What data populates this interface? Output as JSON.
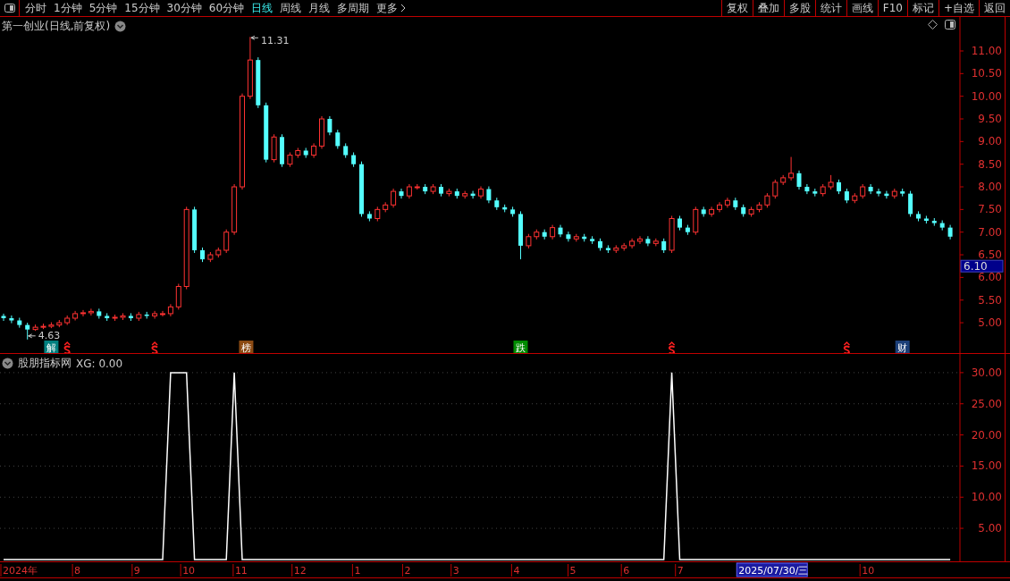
{
  "toolbar": {
    "tabs": [
      {
        "label": "分时",
        "selected": false
      },
      {
        "label": "1分钟",
        "selected": false
      },
      {
        "label": "5分钟",
        "selected": false
      },
      {
        "label": "15分钟",
        "selected": false
      },
      {
        "label": "30分钟",
        "selected": false
      },
      {
        "label": "60分钟",
        "selected": false
      },
      {
        "label": "日线",
        "selected": true
      },
      {
        "label": "周线",
        "selected": false
      },
      {
        "label": "月线",
        "selected": false
      },
      {
        "label": "多周期",
        "selected": false
      },
      {
        "label": "更多",
        "selected": false
      }
    ],
    "buttons": [
      "复权",
      "叠加",
      "多股",
      "统计",
      "画线",
      "F10",
      "标记",
      "+自选",
      "返回"
    ]
  },
  "price_chart": {
    "title": "第一创业(日线,前复权)",
    "last_price": "6.10",
    "chart_data": {
      "type": "candlestick",
      "ylim": [
        4.33,
        11.75
      ],
      "yticks": [
        {
          "value": 5,
          "label": "5.00"
        },
        {
          "value": 5.5,
          "label": "5.50"
        },
        {
          "value": 6,
          "label": "6.00"
        },
        {
          "value": 6.5,
          "label": "6.50"
        },
        {
          "value": 7,
          "label": "7.00"
        },
        {
          "value": 7.5,
          "label": "7.50"
        },
        {
          "value": 8,
          "label": "8.00"
        },
        {
          "value": 8.5,
          "label": "8.50"
        },
        {
          "value": 9,
          "label": "9.00"
        },
        {
          "value": 9.5,
          "label": "9.50"
        },
        {
          "value": 10,
          "label": "10.00"
        },
        {
          "value": 10.5,
          "label": "10.50"
        },
        {
          "value": 11,
          "label": "11.00"
        }
      ],
      "ohlc": [
        [
          5.15,
          5.2,
          5.04,
          5.1
        ],
        [
          5.1,
          5.16,
          4.99,
          5.05
        ],
        [
          5.05,
          5.11,
          4.89,
          4.95
        ],
        [
          4.95,
          5.0,
          4.63,
          4.85
        ],
        [
          4.85,
          4.96,
          4.82,
          4.9
        ],
        [
          4.9,
          4.98,
          4.86,
          4.92
        ],
        [
          4.92,
          5.01,
          4.88,
          4.95
        ],
        [
          4.95,
          5.06,
          4.9,
          5.0
        ],
        [
          5.0,
          5.16,
          4.95,
          5.1
        ],
        [
          5.1,
          5.26,
          5.05,
          5.2
        ],
        [
          5.2,
          5.28,
          5.14,
          5.22
        ],
        [
          5.22,
          5.31,
          5.16,
          5.25
        ],
        [
          5.25,
          5.31,
          5.09,
          5.15
        ],
        [
          5.15,
          5.21,
          5.04,
          5.1
        ],
        [
          5.1,
          5.18,
          5.04,
          5.12
        ],
        [
          5.12,
          5.21,
          5.06,
          5.15
        ],
        [
          5.15,
          5.21,
          5.04,
          5.1
        ],
        [
          5.1,
          5.24,
          5.04,
          5.18
        ],
        [
          5.18,
          5.24,
          5.09,
          5.15
        ],
        [
          5.15,
          5.26,
          5.09,
          5.2
        ],
        [
          5.2,
          5.26,
          5.14,
          5.2
        ],
        [
          5.2,
          5.41,
          5.14,
          5.35
        ],
        [
          5.35,
          5.86,
          5.29,
          5.8
        ],
        [
          5.8,
          7.56,
          5.74,
          7.5
        ],
        [
          7.5,
          7.56,
          6.54,
          6.6
        ],
        [
          6.6,
          6.66,
          6.34,
          6.4
        ],
        [
          6.4,
          6.56,
          6.34,
          6.5
        ],
        [
          6.5,
          6.66,
          6.44,
          6.6
        ],
        [
          6.6,
          7.06,
          6.54,
          7.0
        ],
        [
          7.0,
          8.06,
          6.94,
          8.0
        ],
        [
          8.0,
          10.06,
          7.94,
          10.0
        ],
        [
          10.0,
          11.31,
          9.94,
          10.8
        ],
        [
          10.8,
          10.86,
          9.74,
          9.8
        ],
        [
          9.8,
          9.86,
          8.54,
          8.6
        ],
        [
          8.6,
          9.16,
          8.54,
          9.1
        ],
        [
          9.1,
          9.16,
          8.44,
          8.5
        ],
        [
          8.5,
          8.76,
          8.44,
          8.7
        ],
        [
          8.7,
          8.86,
          8.64,
          8.8
        ],
        [
          8.8,
          8.86,
          8.64,
          8.7
        ],
        [
          8.7,
          8.96,
          8.64,
          8.9
        ],
        [
          8.9,
          9.56,
          8.84,
          9.5
        ],
        [
          9.5,
          9.56,
          9.14,
          9.2
        ],
        [
          9.2,
          9.26,
          8.84,
          8.9
        ],
        [
          8.9,
          8.96,
          8.64,
          8.7
        ],
        [
          8.7,
          8.76,
          8.44,
          8.5
        ],
        [
          8.5,
          8.56,
          7.34,
          7.4
        ],
        [
          7.4,
          7.46,
          7.24,
          7.3
        ],
        [
          7.3,
          7.56,
          7.24,
          7.5
        ],
        [
          7.5,
          7.66,
          7.44,
          7.6
        ],
        [
          7.6,
          7.96,
          7.54,
          7.9
        ],
        [
          7.9,
          7.96,
          7.74,
          7.8
        ],
        [
          7.8,
          8.06,
          7.74,
          8.0
        ],
        [
          8.0,
          8.06,
          7.94,
          8.0
        ],
        [
          8.0,
          8.06,
          7.84,
          7.9
        ],
        [
          7.9,
          8.06,
          7.84,
          8.0
        ],
        [
          8.0,
          8.06,
          7.79,
          7.85
        ],
        [
          7.85,
          7.96,
          7.79,
          7.9
        ],
        [
          7.9,
          7.96,
          7.74,
          7.8
        ],
        [
          7.8,
          7.91,
          7.74,
          7.85
        ],
        [
          7.85,
          7.91,
          7.74,
          7.8
        ],
        [
          7.8,
          8.01,
          7.74,
          7.95
        ],
        [
          7.95,
          8.01,
          7.64,
          7.7
        ],
        [
          7.7,
          7.76,
          7.49,
          7.55
        ],
        [
          7.55,
          7.61,
          7.44,
          7.5
        ],
        [
          7.5,
          7.56,
          7.34,
          7.4
        ],
        [
          7.4,
          7.46,
          6.4,
          6.7
        ],
        [
          6.7,
          6.96,
          6.64,
          6.9
        ],
        [
          6.9,
          7.06,
          6.84,
          7.0
        ],
        [
          7.0,
          7.06,
          6.84,
          6.9
        ],
        [
          6.9,
          7.16,
          6.84,
          7.1
        ],
        [
          7.1,
          7.16,
          6.89,
          6.95
        ],
        [
          6.95,
          7.01,
          6.79,
          6.85
        ],
        [
          6.85,
          6.96,
          6.79,
          6.9
        ],
        [
          6.9,
          6.96,
          6.79,
          6.85
        ],
        [
          6.85,
          6.91,
          6.74,
          6.8
        ],
        [
          6.8,
          6.86,
          6.59,
          6.65
        ],
        [
          6.65,
          6.71,
          6.54,
          6.6
        ],
        [
          6.6,
          6.71,
          6.54,
          6.65
        ],
        [
          6.65,
          6.76,
          6.59,
          6.7
        ],
        [
          6.7,
          6.86,
          6.64,
          6.8
        ],
        [
          6.8,
          6.91,
          6.74,
          6.85
        ],
        [
          6.85,
          6.91,
          6.69,
          6.75
        ],
        [
          6.75,
          6.86,
          6.69,
          6.8
        ],
        [
          6.8,
          6.86,
          6.54,
          6.6
        ],
        [
          6.6,
          7.36,
          6.54,
          7.3
        ],
        [
          7.3,
          7.36,
          7.04,
          7.1
        ],
        [
          7.1,
          7.16,
          6.94,
          7.0
        ],
        [
          7.0,
          7.56,
          6.94,
          7.5
        ],
        [
          7.5,
          7.56,
          7.34,
          7.4
        ],
        [
          7.4,
          7.56,
          7.34,
          7.5
        ],
        [
          7.5,
          7.66,
          7.44,
          7.6
        ],
        [
          7.6,
          7.76,
          7.54,
          7.7
        ],
        [
          7.7,
          7.76,
          7.49,
          7.55
        ],
        [
          7.55,
          7.61,
          7.34,
          7.4
        ],
        [
          7.4,
          7.56,
          7.34,
          7.5
        ],
        [
          7.5,
          7.66,
          7.44,
          7.6
        ],
        [
          7.6,
          7.86,
          7.54,
          7.8
        ],
        [
          7.8,
          8.16,
          7.74,
          8.1
        ],
        [
          8.1,
          8.26,
          8.04,
          8.2
        ],
        [
          8.2,
          8.66,
          8.14,
          8.3
        ],
        [
          8.3,
          8.36,
          7.94,
          8.0
        ],
        [
          8.0,
          8.06,
          7.84,
          7.9
        ],
        [
          7.9,
          7.96,
          7.79,
          7.85
        ],
        [
          7.85,
          8.06,
          7.79,
          8.0
        ],
        [
          8.0,
          8.26,
          7.94,
          8.1
        ],
        [
          8.1,
          8.16,
          7.84,
          7.9
        ],
        [
          7.9,
          7.96,
          7.64,
          7.7
        ],
        [
          7.7,
          7.86,
          7.64,
          7.8
        ],
        [
          7.8,
          8.06,
          7.74,
          8.0
        ],
        [
          8.0,
          8.06,
          7.84,
          7.9
        ],
        [
          7.9,
          7.96,
          7.79,
          7.85
        ],
        [
          7.85,
          7.91,
          7.74,
          7.8
        ],
        [
          7.8,
          7.96,
          7.74,
          7.9
        ],
        [
          7.9,
          7.96,
          7.79,
          7.85
        ],
        [
          7.85,
          7.91,
          7.34,
          7.4
        ],
        [
          7.4,
          7.46,
          7.24,
          7.3
        ],
        [
          7.3,
          7.36,
          7.19,
          7.25
        ],
        [
          7.25,
          7.31,
          7.14,
          7.2
        ],
        [
          7.2,
          7.26,
          7.04,
          7.1
        ],
        [
          7.1,
          7.16,
          6.84,
          6.9
        ]
      ],
      "annotations": [
        "11.31",
        "4.63"
      ]
    },
    "events": [
      {
        "kind": "tag",
        "label": "解",
        "color": "#007f7f"
      },
      {
        "kind": "dollar"
      },
      {
        "kind": "dollar"
      },
      {
        "kind": "tag",
        "label": "榜",
        "color": "#8b4a13"
      },
      {
        "kind": "tag",
        "label": "跌",
        "color": "#008a00"
      },
      {
        "kind": "dollar"
      },
      {
        "kind": "dollar"
      },
      {
        "kind": "tag",
        "label": "财",
        "color": "#1c3f78"
      }
    ]
  },
  "indicator_chart": {
    "title": "股朋指标网",
    "reading": "XG: 0.00",
    "chart_data": {
      "type": "line",
      "grid": true,
      "ylim": [
        -0.3,
        33
      ],
      "yticks": [
        {
          "value": 5,
          "label": "5.00"
        },
        {
          "value": 10,
          "label": "10.00"
        },
        {
          "value": 15,
          "label": "15.00"
        },
        {
          "value": 20,
          "label": "20.00"
        },
        {
          "value": 25,
          "label": "25.00"
        },
        {
          "value": 30,
          "label": "30.00"
        }
      ],
      "series": [
        {
          "color": "#ffffff",
          "values": [
            0,
            0,
            0,
            0,
            0,
            0,
            0,
            0,
            0,
            0,
            0,
            0,
            0,
            0,
            0,
            0,
            0,
            0,
            0,
            0,
            0,
            30,
            30,
            30,
            0,
            0,
            0,
            0,
            0,
            30,
            0,
            0,
            0,
            0,
            0,
            0,
            0,
            0,
            0,
            0,
            0,
            0,
            0,
            0,
            0,
            0,
            0,
            0,
            0,
            0,
            0,
            0,
            0,
            0,
            0,
            0,
            0,
            0,
            0,
            0,
            0,
            0,
            0,
            0,
            0,
            0,
            0,
            0,
            0,
            0,
            0,
            0,
            0,
            0,
            0,
            0,
            0,
            0,
            0,
            0,
            0,
            0,
            0,
            0,
            30,
            0,
            0,
            0,
            0,
            0,
            0,
            0,
            0,
            0,
            0,
            0,
            0,
            0,
            0,
            0,
            0,
            0,
            0,
            0,
            0,
            0,
            0,
            0,
            0,
            0,
            0,
            0,
            0,
            0,
            0,
            0,
            0,
            0,
            0,
            0
          ]
        }
      ]
    }
  },
  "time_axis": {
    "labels": [
      "2024年",
      "8",
      "9",
      "10",
      "11",
      "12",
      "1",
      "2",
      "3",
      "4",
      "5",
      "6",
      "7",
      "10"
    ],
    "cursor_label": "2025/07/30/三"
  }
}
